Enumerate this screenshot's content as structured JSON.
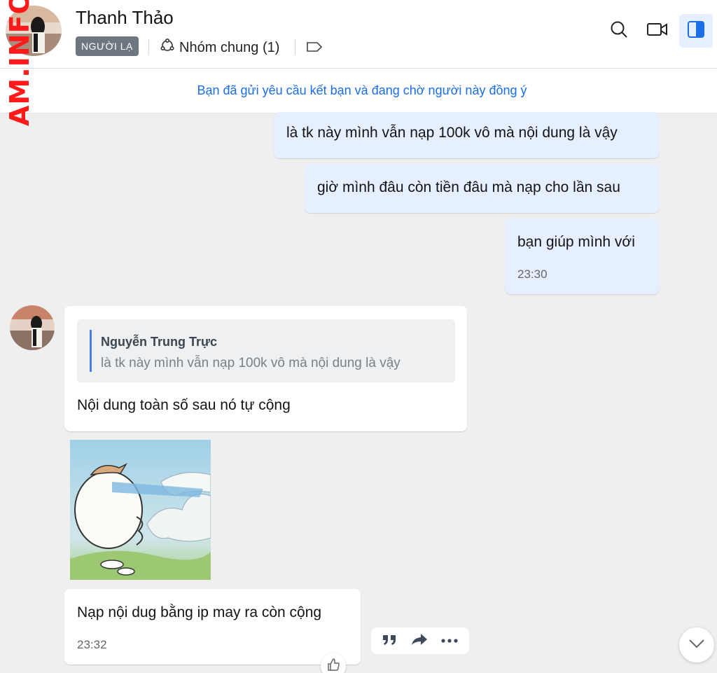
{
  "watermark": "AM.INFO",
  "header": {
    "contact_name": "Thanh Thảo",
    "badge": "NGƯỜI LẠ",
    "common_groups": "Nhóm chung (1)"
  },
  "request_bar": {
    "text": "Bạn đã gửi yêu cầu kết bạn và đang chờ người này đồng ý"
  },
  "messages": {
    "m1": {
      "text": "là tk này mình vẫn nạp 100k vô mà nội dung là vậy"
    },
    "m2": {
      "text": "giờ mình đâu còn tiền đâu mà nạp cho lần sau"
    },
    "m3": {
      "text": "bạn giúp mình với",
      "time": "23:30"
    },
    "m4": {
      "quote_author": "Nguyễn Trung Trực",
      "quote_text": "là tk này mình vẫn nạp 100k vô mà nội dung là vậy",
      "text": "Nội dung toàn số sau nó tự cộng"
    },
    "m6": {
      "text": "Nạp nội dug bằng ip may ra còn cộng",
      "time": "23:32"
    }
  },
  "icons": {
    "search": "search-icon",
    "video": "video-call-icon",
    "panel": "sidebar-toggle-icon",
    "quote": "quote-icon",
    "forward": "forward-icon",
    "more": "more-icon",
    "like": "thumbs-up-icon",
    "scroll": "chevron-down-icon"
  },
  "colors": {
    "accent": "#1a6ee8",
    "my_bubble": "#e5efff",
    "badge_bg": "#6e7780",
    "watermark": "#ff1a1a"
  }
}
